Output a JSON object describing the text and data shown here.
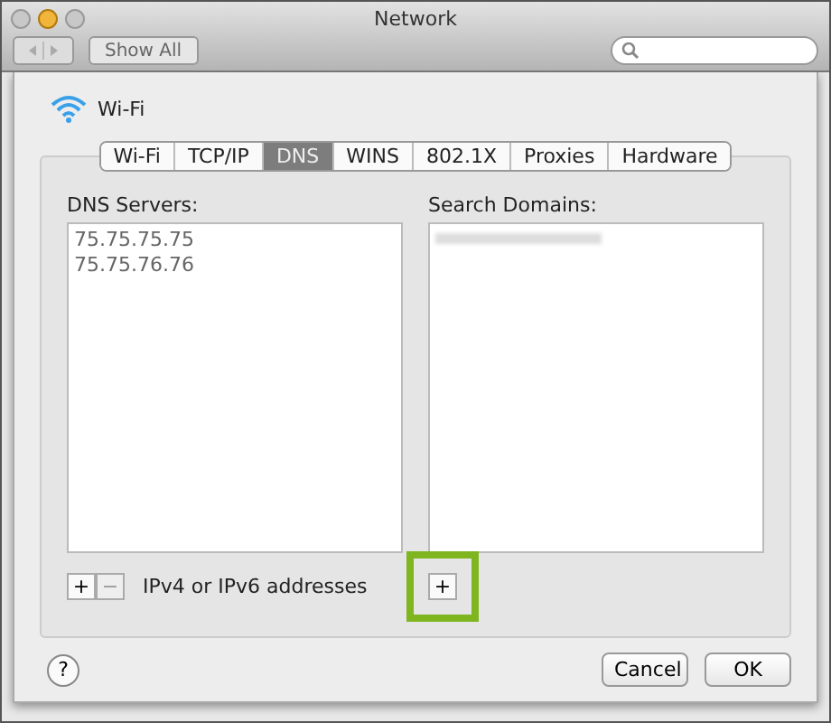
{
  "window": {
    "title": "Network"
  },
  "toolbar": {
    "show_all": "Show All"
  },
  "service": {
    "name": "Wi-Fi"
  },
  "tabs": [
    {
      "label": "Wi-Fi",
      "selected": false
    },
    {
      "label": "TCP/IP",
      "selected": false
    },
    {
      "label": "DNS",
      "selected": true
    },
    {
      "label": "WINS",
      "selected": false
    },
    {
      "label": "802.1X",
      "selected": false
    },
    {
      "label": "Proxies",
      "selected": false
    },
    {
      "label": "Hardware",
      "selected": false
    }
  ],
  "dns_servers": {
    "label": "DNS Servers:",
    "entries": [
      "75.75.75.75",
      "75.75.76.76"
    ],
    "add": "+",
    "remove": "−",
    "hint": "IPv4 or IPv6 addresses"
  },
  "search_domains": {
    "label": "Search Domains:",
    "add": "+",
    "highlighted": true
  },
  "buttons": [
    "Cancel",
    "OK"
  ],
  "help": "?"
}
